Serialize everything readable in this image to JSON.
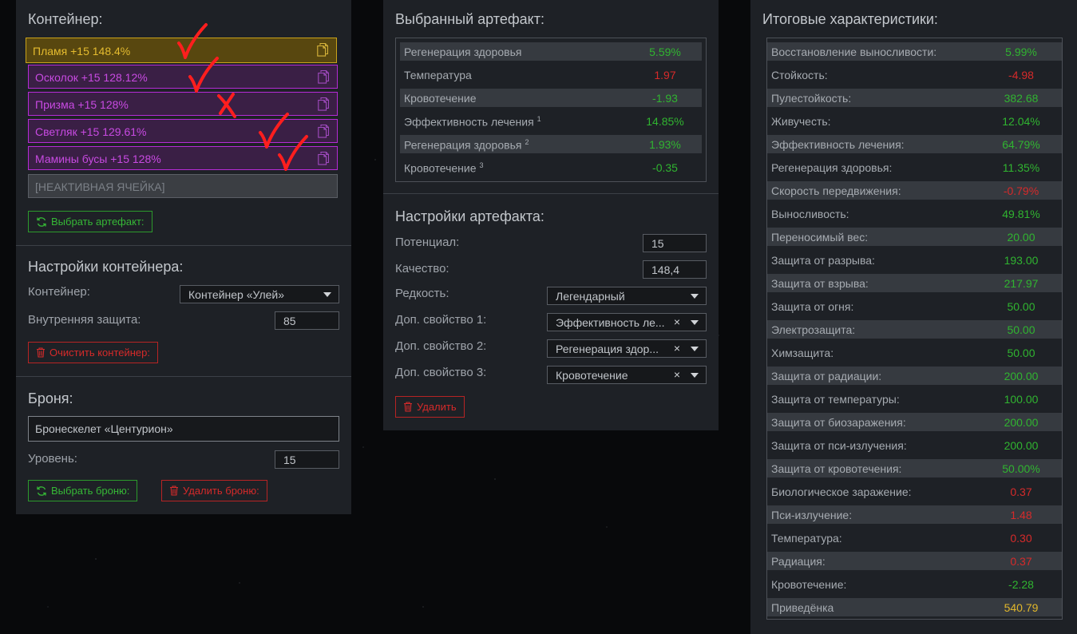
{
  "container": {
    "title": "Контейнер:",
    "slots": [
      {
        "text": "Пламя +15 148.4%",
        "style": "gold"
      },
      {
        "text": "Осколок +15 128.12%",
        "style": "purple"
      },
      {
        "text": "Призма +15 128%",
        "style": "purple"
      },
      {
        "text": "Светляк +15 129.61%",
        "style": "purple"
      },
      {
        "text": "Мамины бусы +15 128%",
        "style": "purple"
      },
      {
        "text": "[НЕАКТИВНАЯ ЯЧЕЙКА]",
        "style": "inactive"
      }
    ],
    "select_artifact_button": "Выбрать артефакт:"
  },
  "annotations": {
    "color": "#ff1e1e",
    "marks": [
      "check",
      "check",
      "cross",
      "check",
      "check"
    ]
  },
  "container_settings": {
    "title": "Настройки контейнера:",
    "container_label": "Контейнер:",
    "container_value": "Контейнер «Улей»",
    "inner_protection_label": "Внутренняя защита:",
    "inner_protection_value": "85",
    "clear_button": "Очистить контейнер:"
  },
  "armor": {
    "title": "Броня:",
    "name": "Бронескелет «Центурион»",
    "level_label": "Уровень:",
    "level_value": "15",
    "select_button": "Выбрать броню:",
    "delete_button": "Удалить броню:"
  },
  "selected_artifact": {
    "title": "Выбранный артефакт:",
    "stats": [
      {
        "name": "Регенерация здоровья",
        "sup": "",
        "value": "5.59%",
        "sign": "pos"
      },
      {
        "name": "Температура",
        "sup": "",
        "value": "1.97",
        "sign": "neg"
      },
      {
        "name": "Кровотечение",
        "sup": "",
        "value": "-1.93",
        "sign": "pos"
      },
      {
        "name": "Эффективность лечения",
        "sup": "1",
        "value": "14.85%",
        "sign": "pos"
      },
      {
        "name": "Регенерация здоровья",
        "sup": "2",
        "value": "1.93%",
        "sign": "pos"
      },
      {
        "name": "Кровотечение",
        "sup": "3",
        "value": "-0.35",
        "sign": "pos"
      }
    ]
  },
  "artifact_settings": {
    "title": "Настройки артефакта:",
    "potential_label": "Потенциал:",
    "potential_value": "15",
    "quality_label": "Качество:",
    "quality_value": "148,4",
    "rarity_label": "Редкость:",
    "rarity_value": "Легендарный",
    "extra1_label": "Доп. свойство 1:",
    "extra1_value": "Эффективность ле...",
    "extra2_label": "Доп. свойство 2:",
    "extra2_value": "Регенерация здор...",
    "extra3_label": "Доп. свойство 3:",
    "extra3_value": "Кровотечение",
    "clear_glyph": "×",
    "delete_button": "Удалить"
  },
  "totals": {
    "title": "Итоговые характеристики:",
    "stats": [
      {
        "name": "Восстановление выносливости:",
        "value": "5.99%",
        "sign": "pos"
      },
      {
        "name": "Стойкость:",
        "value": "-4.98",
        "sign": "neg"
      },
      {
        "name": "Пулестойкость:",
        "value": "382.68",
        "sign": "pos"
      },
      {
        "name": "Живучесть:",
        "value": "12.04%",
        "sign": "pos"
      },
      {
        "name": "Эффективность лечения:",
        "value": "64.79%",
        "sign": "pos"
      },
      {
        "name": "Регенерация здоровья:",
        "value": "11.35%",
        "sign": "pos"
      },
      {
        "name": "Скорость передвижения:",
        "value": "-0.79%",
        "sign": "neg"
      },
      {
        "name": "Выносливость:",
        "value": "49.81%",
        "sign": "pos"
      },
      {
        "name": "Переносимый вес:",
        "value": "20.00",
        "sign": "pos"
      },
      {
        "name": "Защита от разрыва:",
        "value": "193.00",
        "sign": "pos"
      },
      {
        "name": "Защита от взрыва:",
        "value": "217.97",
        "sign": "pos"
      },
      {
        "name": "Защита от огня:",
        "value": "50.00",
        "sign": "pos"
      },
      {
        "name": "Электрозащита:",
        "value": "50.00",
        "sign": "pos"
      },
      {
        "name": "Химзащита:",
        "value": "50.00",
        "sign": "pos"
      },
      {
        "name": "Защита от радиации:",
        "value": "200.00",
        "sign": "pos"
      },
      {
        "name": "Защита от температуры:",
        "value": "100.00",
        "sign": "pos"
      },
      {
        "name": "Защита от биозаражения:",
        "value": "200.00",
        "sign": "pos"
      },
      {
        "name": "Защита от пси-излучения:",
        "value": "200.00",
        "sign": "pos"
      },
      {
        "name": "Защита от кровотечения:",
        "value": "50.00%",
        "sign": "pos"
      },
      {
        "name": "Биологическое заражение:",
        "value": "0.37",
        "sign": "neg"
      },
      {
        "name": "Пси-излучение:",
        "value": "1.48",
        "sign": "neg"
      },
      {
        "name": "Температура:",
        "value": "0.30",
        "sign": "neg"
      },
      {
        "name": "Радиация:",
        "value": "0.37",
        "sign": "neg"
      },
      {
        "name": "Кровотечение:",
        "value": "-2.28",
        "sign": "pos"
      },
      {
        "name": "Приведёнка",
        "value": "540.79",
        "sign": "gold"
      }
    ]
  }
}
